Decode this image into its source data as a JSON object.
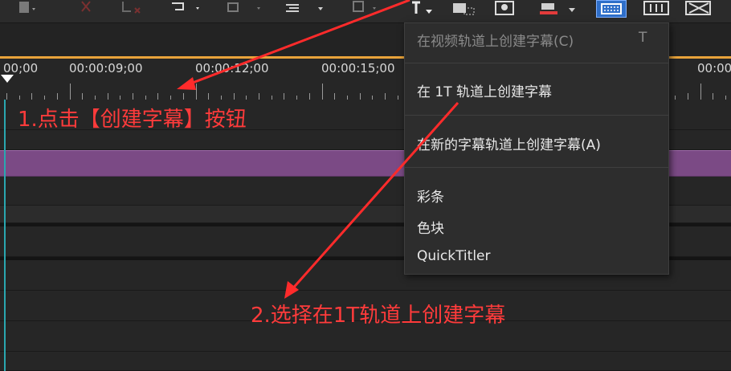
{
  "ruler": {
    "timecodes": [
      "00;00",
      "00:00:09;00",
      "00:00:12;00",
      "00:00:15;00",
      "00:00"
    ]
  },
  "menu": {
    "items": [
      {
        "label": "在视频轨道上创建字幕(C)",
        "shortcut": "T",
        "disabled": true
      },
      {
        "label": "在 1T 轨道上创建字幕",
        "shortcut": "",
        "disabled": false
      },
      {
        "label": "在新的字幕轨道上创建字幕(A)",
        "shortcut": "",
        "disabled": false
      },
      {
        "label": "彩条",
        "shortcut": "",
        "disabled": false
      },
      {
        "label": "色块",
        "shortcut": "",
        "disabled": false
      },
      {
        "label": "QuickTitler",
        "shortcut": "",
        "disabled": false
      }
    ]
  },
  "annotations": {
    "step1": "1.点击【创建字幕】按钮",
    "step2": "2.选择在1T轨道上创建字幕"
  },
  "toolbar": {
    "icons": [
      "link-icon",
      "delete-icon",
      "ripple-delete-icon",
      "undo-icon",
      "export-icon",
      "align-icon",
      "trim-icon",
      "create-title-icon",
      "snapshot-icon",
      "record-icon",
      "color-icon",
      "subtitle-grid-icon",
      "mixer-icon",
      "transparency-icon"
    ]
  },
  "colors": {
    "accent_orange": "#e8a33a",
    "clip_purple": "#7b4a85",
    "annotation_red": "#ff3b3b",
    "playhead_cyan": "#2aa7b0"
  }
}
